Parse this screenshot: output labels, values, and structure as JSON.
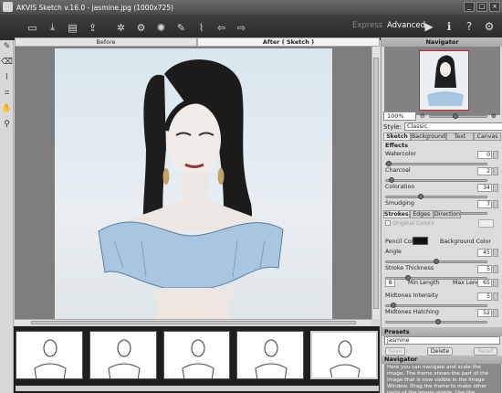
{
  "window": {
    "title": "AKVIS Sketch v.16.0 - jasmine.jpg (1000x725)",
    "controls": [
      "_",
      "□",
      "×"
    ]
  },
  "toolbar": {
    "modes": {
      "express": "Express",
      "advanced": "Advanced"
    }
  },
  "canvas_tabs": {
    "before": "Before",
    "after": "After ( Sketch )"
  },
  "navigator": {
    "title": "Navigator",
    "zoom": "100%"
  },
  "style": {
    "label": "Style:",
    "value": "Classic"
  },
  "settings_tabs": [
    "Sketch",
    "Background",
    "Text",
    "Canvas"
  ],
  "effects": {
    "title": "Effects",
    "params": [
      {
        "label": "Watercolor",
        "value": "0",
        "level": 0.0
      },
      {
        "label": "Charcoal",
        "value": "2",
        "level": 0.03
      },
      {
        "label": "Coloration",
        "value": "34",
        "level": 0.34
      },
      {
        "label": "Smudging",
        "value": "7",
        "level": 0.07
      }
    ]
  },
  "stroke_tabs": [
    "Strokes",
    "Edges",
    "Direction"
  ],
  "strokes": {
    "original_colors": "Original Colors",
    "pencil_color_label": "Pencil Color",
    "background_color_label": "Background Color",
    "pencil_color": "#111111",
    "background_color": "#ffffff",
    "angle": {
      "label": "Angle",
      "value": "45",
      "level": 0.5
    },
    "stroke_thickness": {
      "label": "Stroke Thickness",
      "value": "5",
      "level": 0.2
    },
    "min_length_label": "Min Length",
    "min_length": "8",
    "max_length_label": "Max Length",
    "max_length": "65",
    "midtones_intensity": {
      "label": "Midtones Intensity",
      "value": "5",
      "level": 0.05
    },
    "midtones_hatching": {
      "label": "Midtones Hatching",
      "value": "52",
      "level": 0.52
    }
  },
  "presets": {
    "title": "Presets",
    "value": "jasmine",
    "save": "Save",
    "delete": "Delete",
    "reset": "Reset"
  },
  "help": {
    "title": "Navigator",
    "text": "Here you can navigate and scale the image. The frame shows the part of the image that is now visible in the Image Window. Drag the frame to make other parts of the image visible. Use the"
  },
  "icons": [
    "brush-icon",
    "open-icon",
    "save-icon",
    "print-icon",
    "share-icon",
    "batch-icon",
    "plugin-icon",
    "run-icon",
    "eraser-icon",
    "undo-icon",
    "redo-icon",
    "play-icon",
    "info-icon",
    "help-icon",
    "settings-icon"
  ]
}
